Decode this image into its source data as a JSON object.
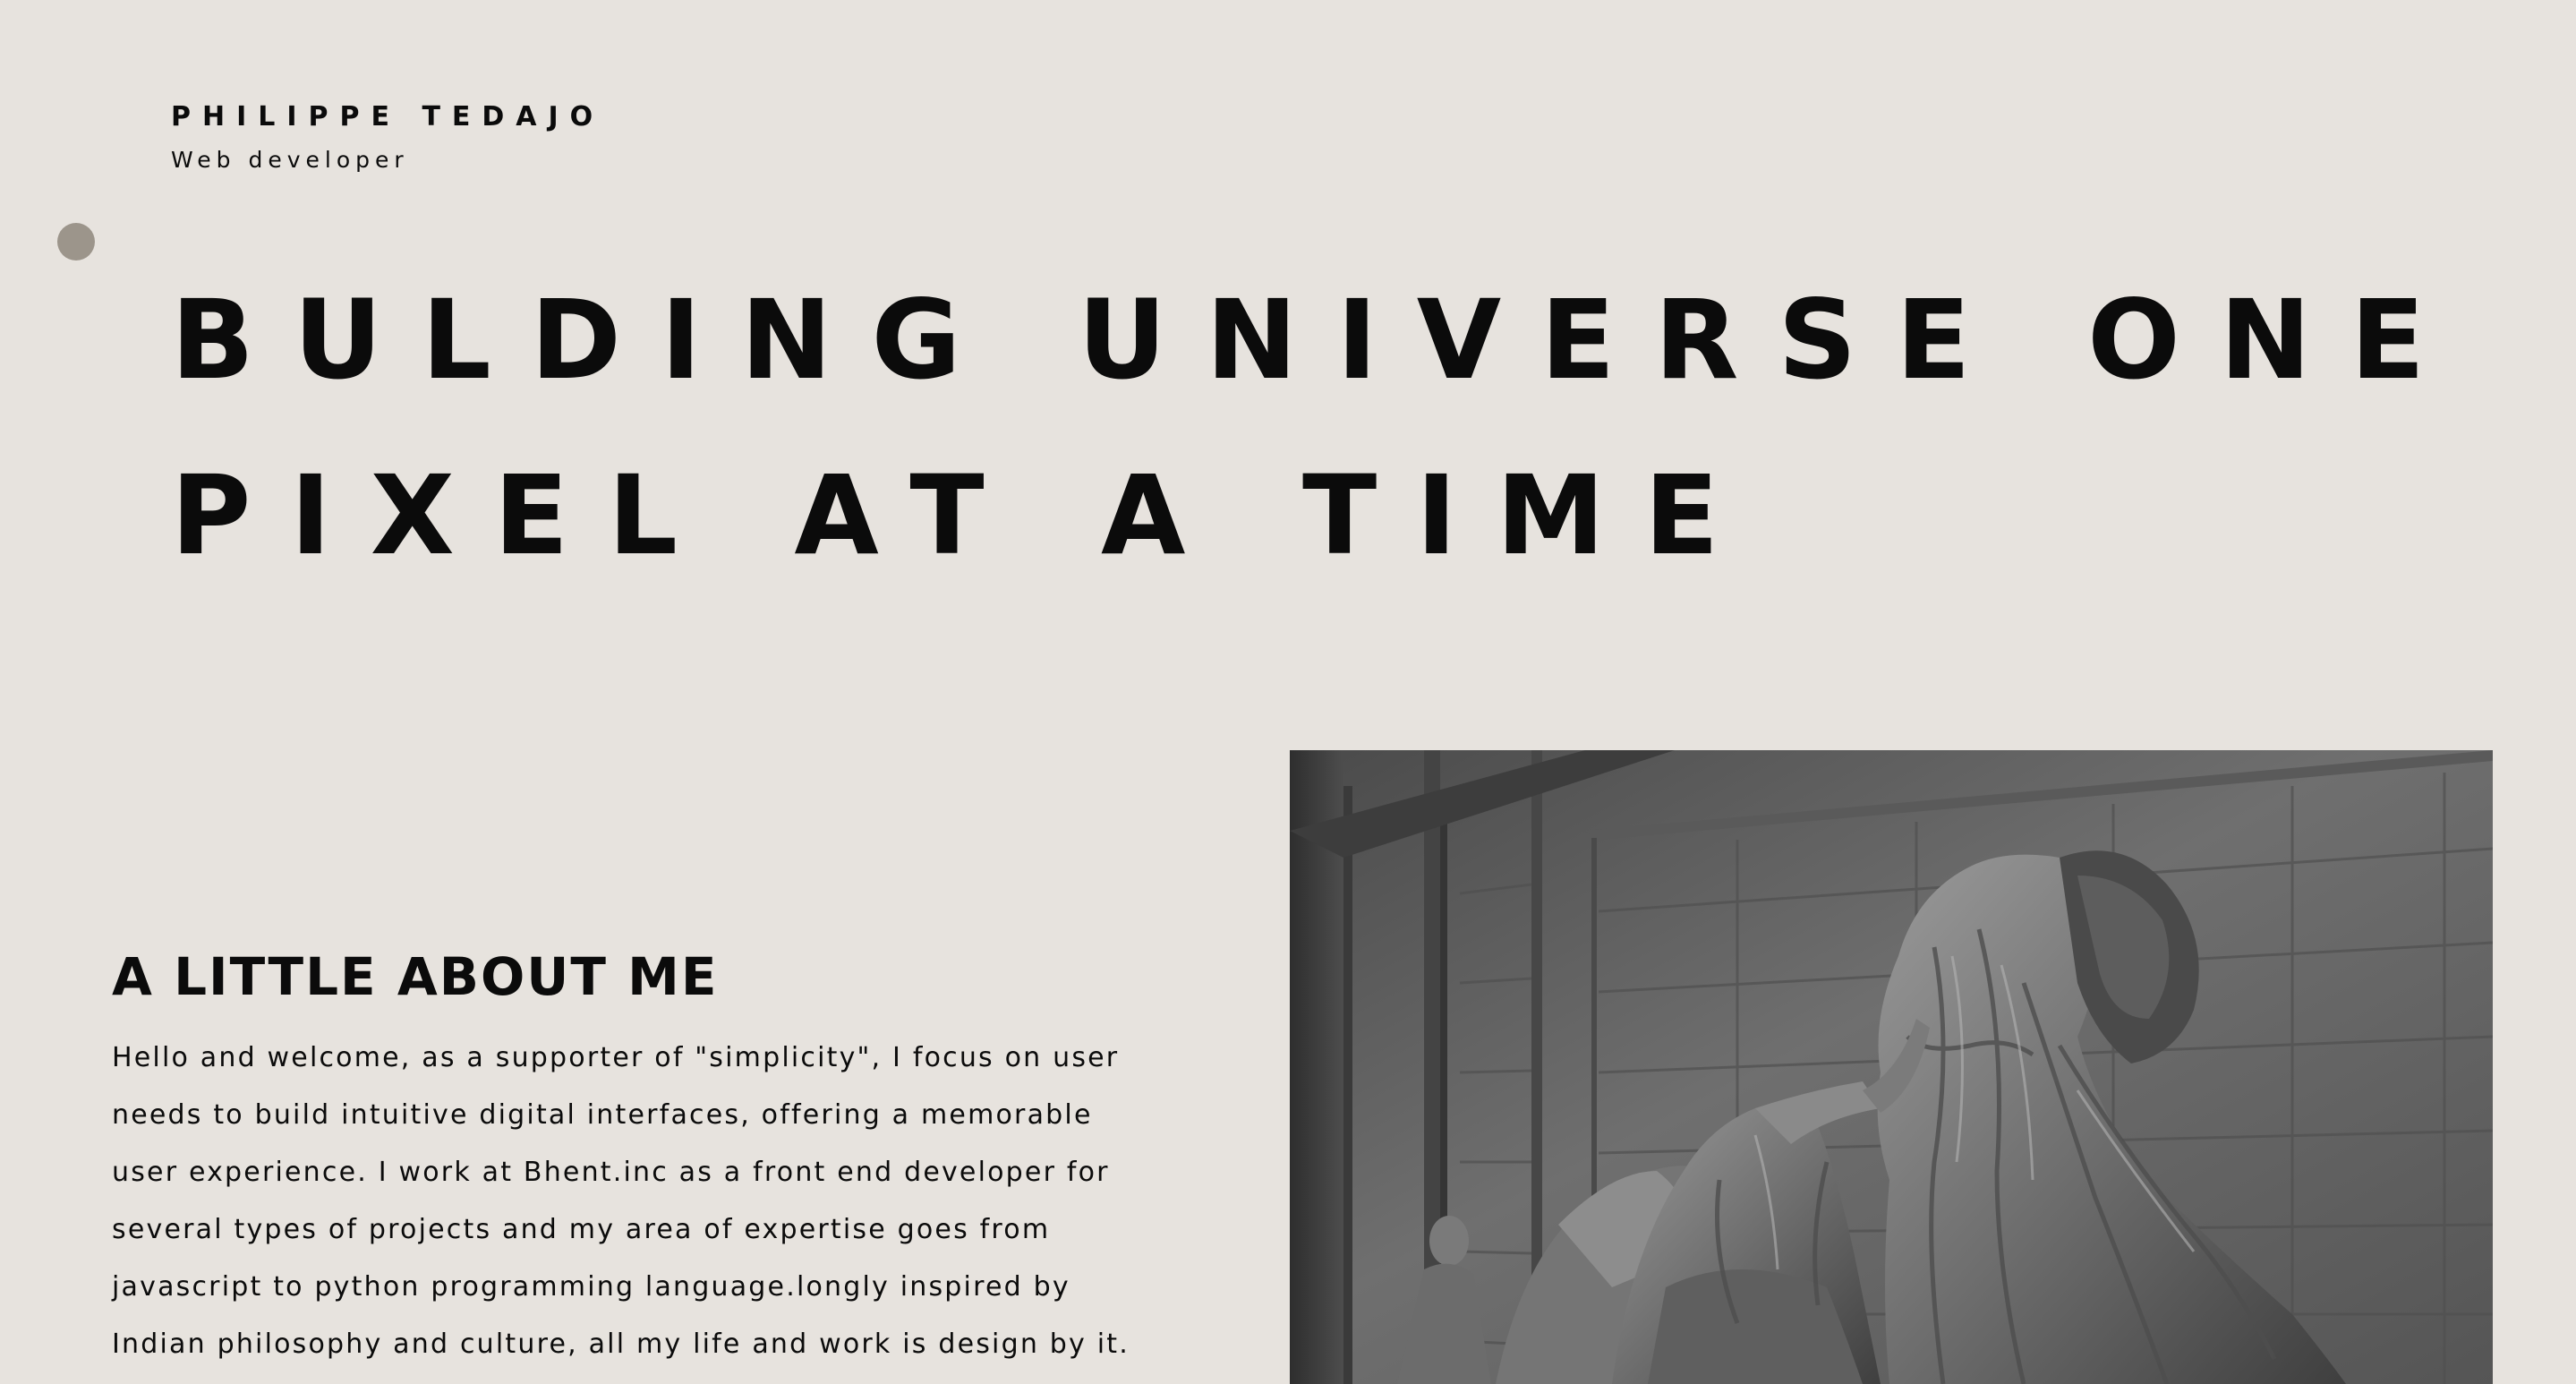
{
  "header": {
    "name": "PHILIPPE TEDAJO",
    "role": "Web developer"
  },
  "hero": {
    "line1": "BULDING UNIVERSE ONE",
    "line2": "PIXEL AT A TIME"
  },
  "about": {
    "title": "A LITTLE ABOUT ME",
    "lines": [
      "Hello and welcome, as a supporter of \"simplicity\", I focus on user",
      "needs to build intuitive digital interfaces, offering a memorable",
      "user experience. I work at Bhent.inc as a front end developer for",
      "several types of projects and my area of expertise goes from",
      "javascript to python programming language.longly inspired by",
      "Indian philosophy and culture, all my life and work is design by it."
    ]
  },
  "photo": {
    "subject": "black-and-white photo of classical marble statues against a stone wall"
  },
  "colors": {
    "background": "#e7e3de",
    "text": "#0b0b0b",
    "accent_dot": "#9c958b"
  }
}
